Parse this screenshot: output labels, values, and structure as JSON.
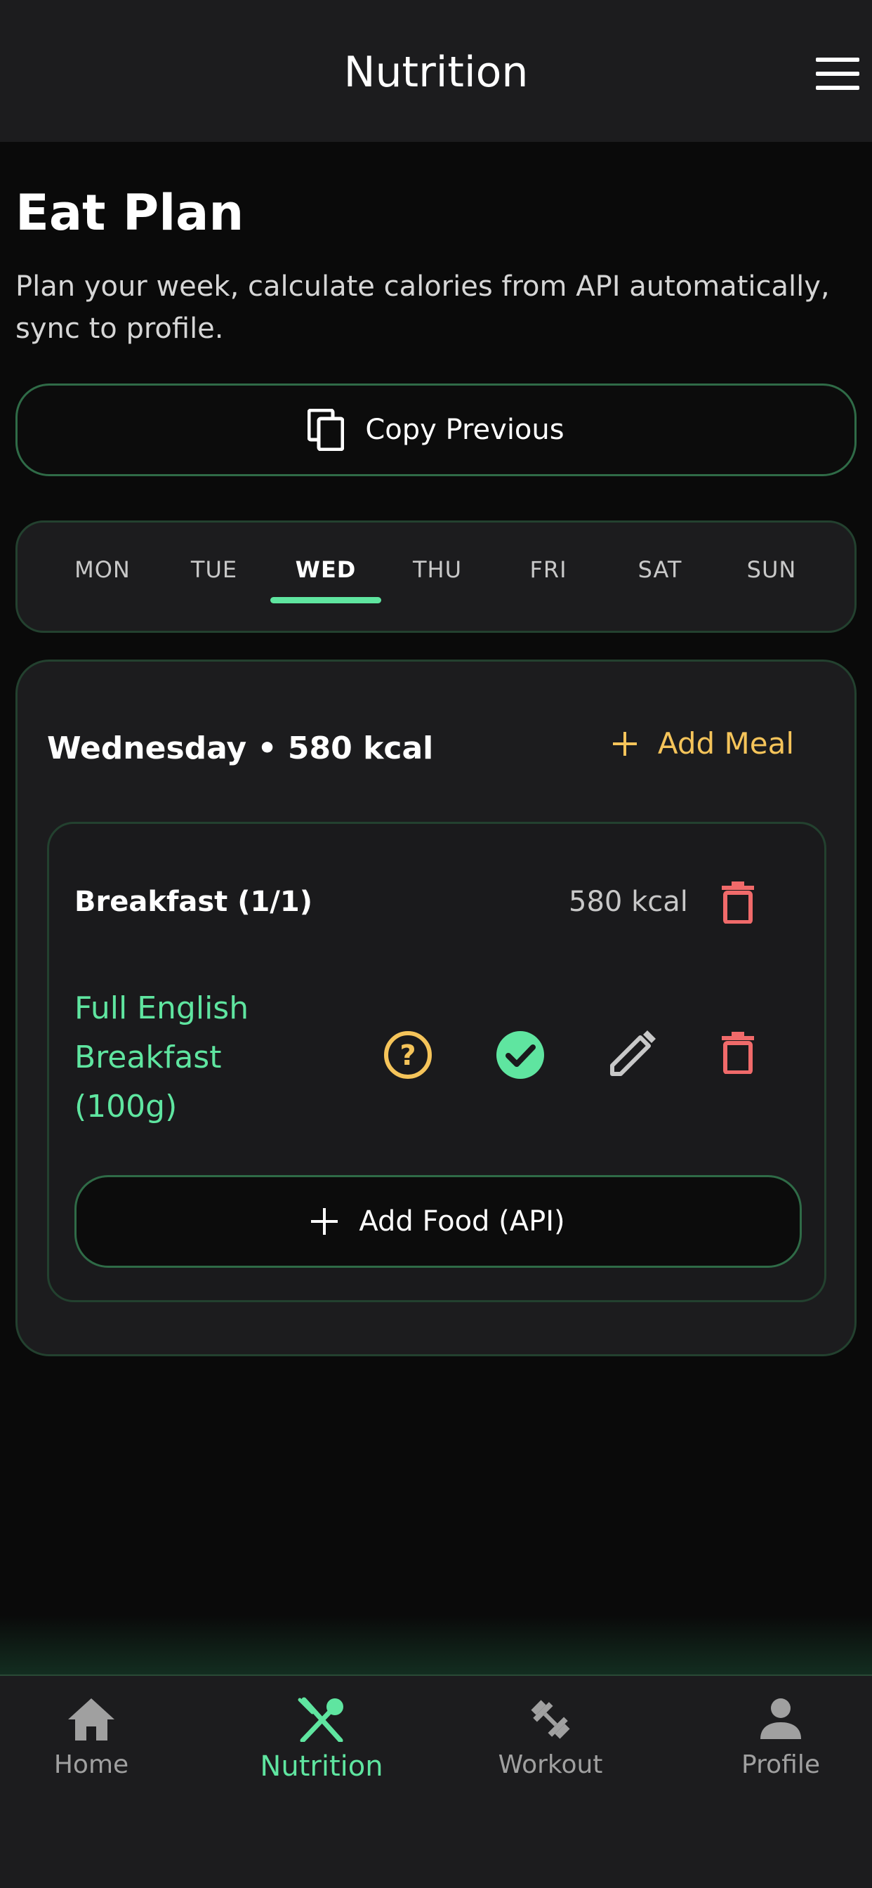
{
  "header": {
    "title": "Nutrition"
  },
  "page": {
    "title": "Eat Plan",
    "subtitle": "Plan your week, calculate calories from API automatically, sync to profile."
  },
  "copy_button": {
    "label": "Copy Previous"
  },
  "days": [
    {
      "label": "MON"
    },
    {
      "label": "TUE"
    },
    {
      "label": "WED"
    },
    {
      "label": "THU"
    },
    {
      "label": "FRI"
    },
    {
      "label": "SAT"
    },
    {
      "label": "SUN"
    }
  ],
  "selected_day": "WED",
  "day_card": {
    "summary": "Wednesday • 580 kcal",
    "add_meal_label": "Add Meal",
    "meal": {
      "title": "Breakfast (1/1)",
      "kcal": "580 kcal",
      "food": "Full English Breakfast (100g)",
      "add_food_label": "Add Food (API)"
    }
  },
  "nav": {
    "home": "Home",
    "nutrition": "Nutrition",
    "workout": "Workout",
    "profile": "Profile"
  },
  "colors": {
    "accent_green": "#5fe5a0",
    "accent_yellow": "#f5c45a",
    "danger_red": "#f06a6a",
    "card_border": "#23412f"
  },
  "icons": {
    "menu": "hamburger-menu-icon",
    "copy": "copy-icon",
    "add": "plus-icon",
    "delete": "trash-icon",
    "info": "help-circle-icon",
    "confirm": "check-circle-icon",
    "edit": "pencil-icon",
    "home": "home-icon",
    "nutrition": "fork-spoon-icon",
    "workout": "dumbbell-icon",
    "profile": "person-icon"
  }
}
